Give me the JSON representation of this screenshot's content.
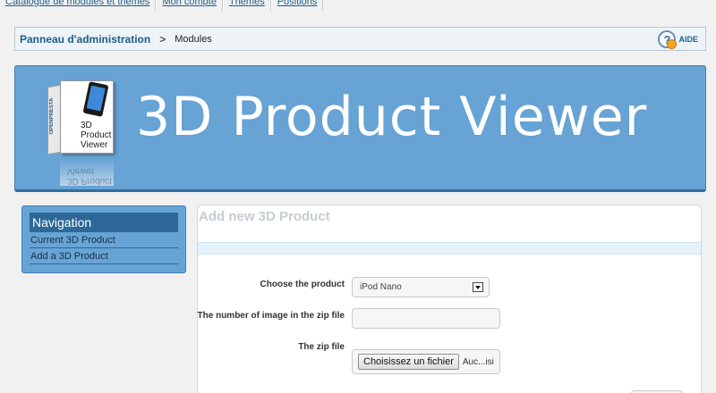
{
  "top_tabs": [
    {
      "label": "Catalogue de modules et thèmes"
    },
    {
      "label": "Mon compte"
    },
    {
      "label": "Thèmes"
    },
    {
      "label": "Positions"
    }
  ],
  "breadcrumb": {
    "home": "Panneau d'administration",
    "separator": ">",
    "current": "Modules",
    "help_label": "AIDE",
    "help_glyph": "?"
  },
  "banner": {
    "title": "3D Product Viewer",
    "box_side_text": "OPENPRESTA",
    "box_text": "3D Product Viewer",
    "box_reflection_text": "3D Product Viewer",
    "background_color": "#67a3d4"
  },
  "navigation": {
    "title": "Navigation",
    "items": [
      {
        "label": "Current 3D Product"
      },
      {
        "label": "Add a 3D Product"
      }
    ]
  },
  "form": {
    "title": "Add new 3D Product",
    "product_label": "Choose the product",
    "product_selected": "iPod Nano",
    "image_count_label": "The number of image in the zip file",
    "image_count_value": "",
    "zip_label": "The zip file",
    "file_button": "Choisissez un fichier",
    "file_status": "Auc...isi"
  }
}
